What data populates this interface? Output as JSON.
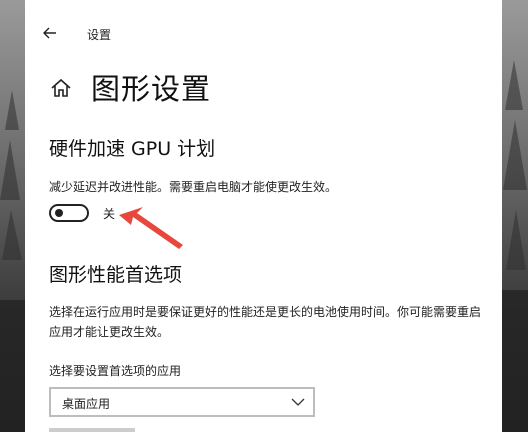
{
  "window": {
    "title": "设置"
  },
  "header": {
    "page_title": "图形设置"
  },
  "gpu_section": {
    "title": "硬件加速 GPU 计划",
    "description": "减少延迟并改进性能。需要重启电脑才能使更改生效。",
    "toggle_state": "关",
    "toggle_on": false
  },
  "prefs_section": {
    "title": "图形性能首选项",
    "description": "选择在运行应用时是要保证更好的性能还是更长的电池使用时间。你可能需要重启应用才能让更改生效。",
    "select_label": "选择要设置首选项的应用",
    "select_value": "桌面应用"
  },
  "colors": {
    "annotation_arrow": "#e8473b",
    "text": "#111111",
    "window_bg": "#ffffff"
  },
  "icons": {
    "back": "back-arrow-icon",
    "home": "home-icon",
    "dropdown": "chevron-down-icon"
  }
}
